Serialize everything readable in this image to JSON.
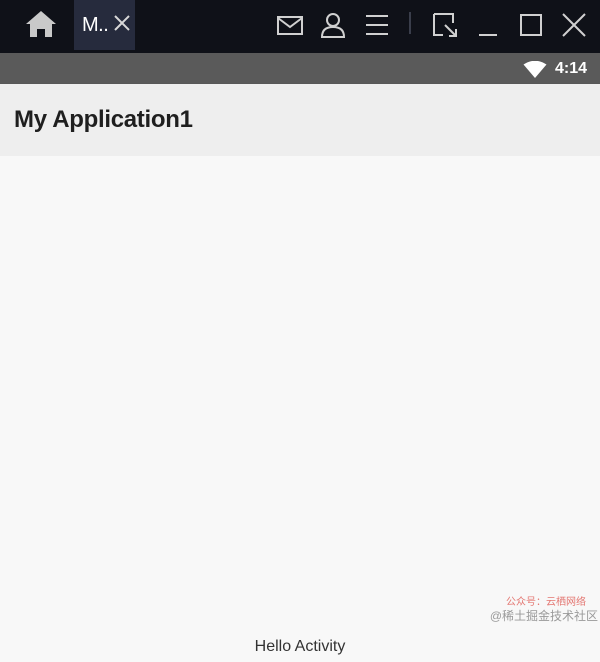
{
  "titlebar": {
    "tab_label": "M..",
    "icons": [
      "home-icon",
      "close-icon",
      "mail-icon",
      "user-icon",
      "menu-icon",
      "screenshot-icon",
      "minimize-icon",
      "maximize-icon",
      "close-window-icon"
    ]
  },
  "statusbar": {
    "time": "4:14",
    "icons": [
      "wifi-icon"
    ]
  },
  "appbar": {
    "title": "My Application1"
  },
  "content": {
    "hello_text": "Hello Activity"
  },
  "watermark": {
    "line1": "公众号：云栖网络",
    "line2": "@稀土掘金技术社区"
  },
  "colors": {
    "titlebar_bg": "#0f1118",
    "tab_bg": "#262b3d",
    "statusbar_bg": "#5a5a5a",
    "appbar_bg": "#eeeeee",
    "content_bg": "#f8f8f8"
  }
}
